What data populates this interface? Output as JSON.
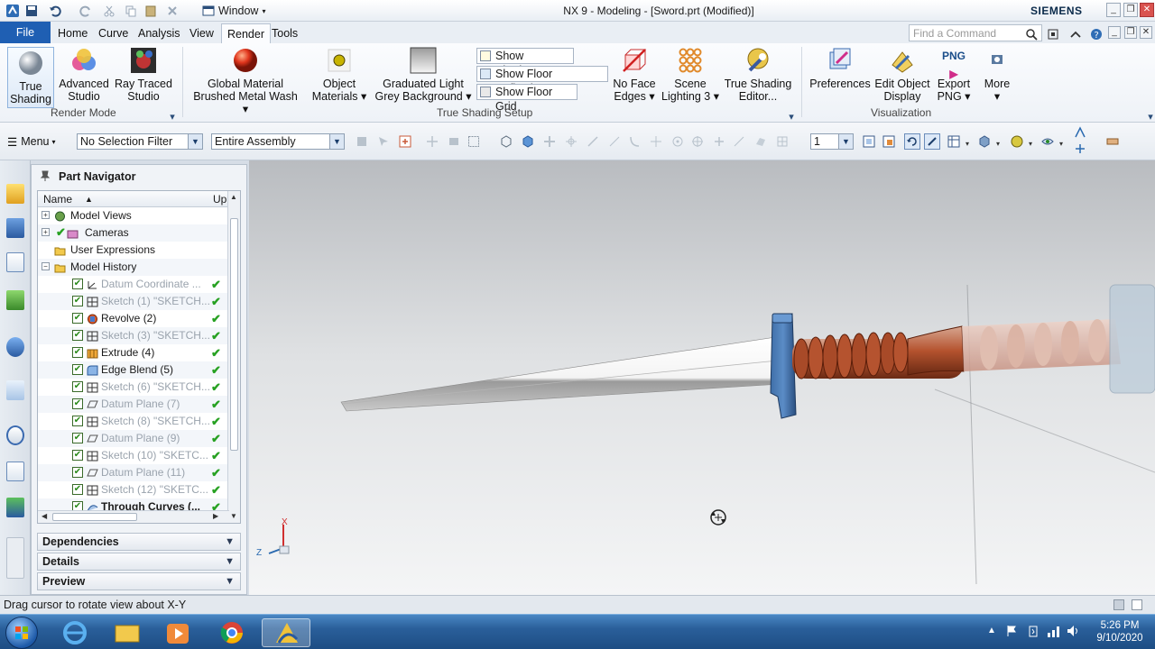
{
  "titlebar": {
    "window_menu": "Window",
    "title": "NX 9 - Modeling - [Sword.prt (Modified)]",
    "brand": "SIEMENS"
  },
  "tabs": [
    {
      "label": "File"
    },
    {
      "label": "Home"
    },
    {
      "label": "Curve"
    },
    {
      "label": "Analysis"
    },
    {
      "label": "View"
    },
    {
      "label": "Render"
    },
    {
      "label": "Tools"
    }
  ],
  "command_search": {
    "placeholder": "Find a Command"
  },
  "ribbon": {
    "true_shading": "True Shading",
    "advanced_studio": "Advanced Studio",
    "ray_traced_studio": "Ray Traced Studio",
    "render_mode": "Render Mode",
    "global_material_1": "Global Material",
    "global_material_2": "Brushed Metal Wash",
    "object_materials_1": "Object",
    "object_materials_2": "Materials",
    "background_1": "Graduated Light",
    "background_2": "Grey Background",
    "show_shadows": "Show Shadows",
    "show_floor_reflection": "Show Floor Reflection",
    "show_floor_grid": "Show Floor Grid",
    "face_edges_1": "No Face",
    "face_edges_2": "Edges",
    "scene_lighting_1": "Scene",
    "scene_lighting_2": "Lighting 3",
    "ts_editor_1": "True Shading",
    "ts_editor_2": "Editor...",
    "true_shading_setup": "True Shading Setup",
    "preferences": "Preferences",
    "edit_display_1": "Edit Object",
    "edit_display_2": "Display",
    "export_png_1": "Export",
    "export_png_2": "PNG",
    "export_png_icon_text": "PNG",
    "more": "More",
    "visualization": "Visualization"
  },
  "selection_bar": {
    "menu": "Menu",
    "filter": "No Selection Filter",
    "scope": "Entire Assembly",
    "layer": "1"
  },
  "navigator": {
    "title": "Part Navigator",
    "col_name": "Name",
    "col_uptodate": "Up tc",
    "rows": [
      {
        "label": "Model Views"
      },
      {
        "label": "Cameras"
      },
      {
        "label": "User Expressions"
      },
      {
        "label": "Model History"
      },
      {
        "label": "Datum Coordinate ..."
      },
      {
        "label": "Sketch (1) \"SKETCH..."
      },
      {
        "label": "Revolve (2)"
      },
      {
        "label": "Sketch (3) \"SKETCH..."
      },
      {
        "label": "Extrude (4)"
      },
      {
        "label": "Edge Blend (5)"
      },
      {
        "label": "Sketch (6) \"SKETCH..."
      },
      {
        "label": "Datum Plane (7)"
      },
      {
        "label": "Sketch (8) \"SKETCH..."
      },
      {
        "label": "Datum Plane (9)"
      },
      {
        "label": "Sketch (10) \"SKETC..."
      },
      {
        "label": "Datum Plane (11)"
      },
      {
        "label": "Sketch (12) \"SKETC..."
      },
      {
        "label": "Through Curves (..."
      }
    ],
    "panels": {
      "dependencies": "Dependencies",
      "details": "Details",
      "preview": "Preview"
    }
  },
  "viewport": {
    "triad_x": "X",
    "triad_z": "Z"
  },
  "cue_line": "Drag cursor to rotate view about X-Y",
  "taskbar": {
    "time": "5:26 PM",
    "date": "9/10/2020"
  }
}
